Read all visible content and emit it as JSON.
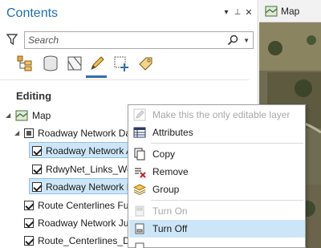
{
  "pane": {
    "title": "Contents",
    "menu_glyph": "▾",
    "pin_glyph": "⊥",
    "close_glyph": "✕",
    "search_placeholder": "Search",
    "section_heading": "Editing"
  },
  "tree": {
    "map": "Map",
    "group": "Roadway Network Data",
    "layers": [
      "Roadway Network Ac",
      "RdwyNet_Links_Work",
      "Roadway Network Lin",
      "Route Centerlines Func",
      "Roadway Network Junc",
      "Route_Centerlines_Draf"
    ]
  },
  "map_tab": {
    "label": "Map"
  },
  "context_menu": {
    "items": [
      {
        "label": "Make this the only editable layer",
        "icon": "editable-icon",
        "disabled": true
      },
      {
        "label": "Attributes",
        "icon": "table-icon",
        "disabled": false
      },
      {
        "label": "Copy",
        "icon": "copy-icon",
        "disabled": false
      },
      {
        "label": "Remove",
        "icon": "remove-icon",
        "disabled": false
      },
      {
        "label": "Group",
        "icon": "group-icon",
        "disabled": false
      },
      {
        "label": "Turn On",
        "icon": "turn-on-icon",
        "disabled": true
      },
      {
        "label": "Turn Off",
        "icon": "turn-off-icon",
        "disabled": false,
        "hover": true
      }
    ]
  },
  "colors": {
    "accent": "#1f6fb5",
    "selection": "#cde6f7",
    "hover": "#cde6f7"
  }
}
